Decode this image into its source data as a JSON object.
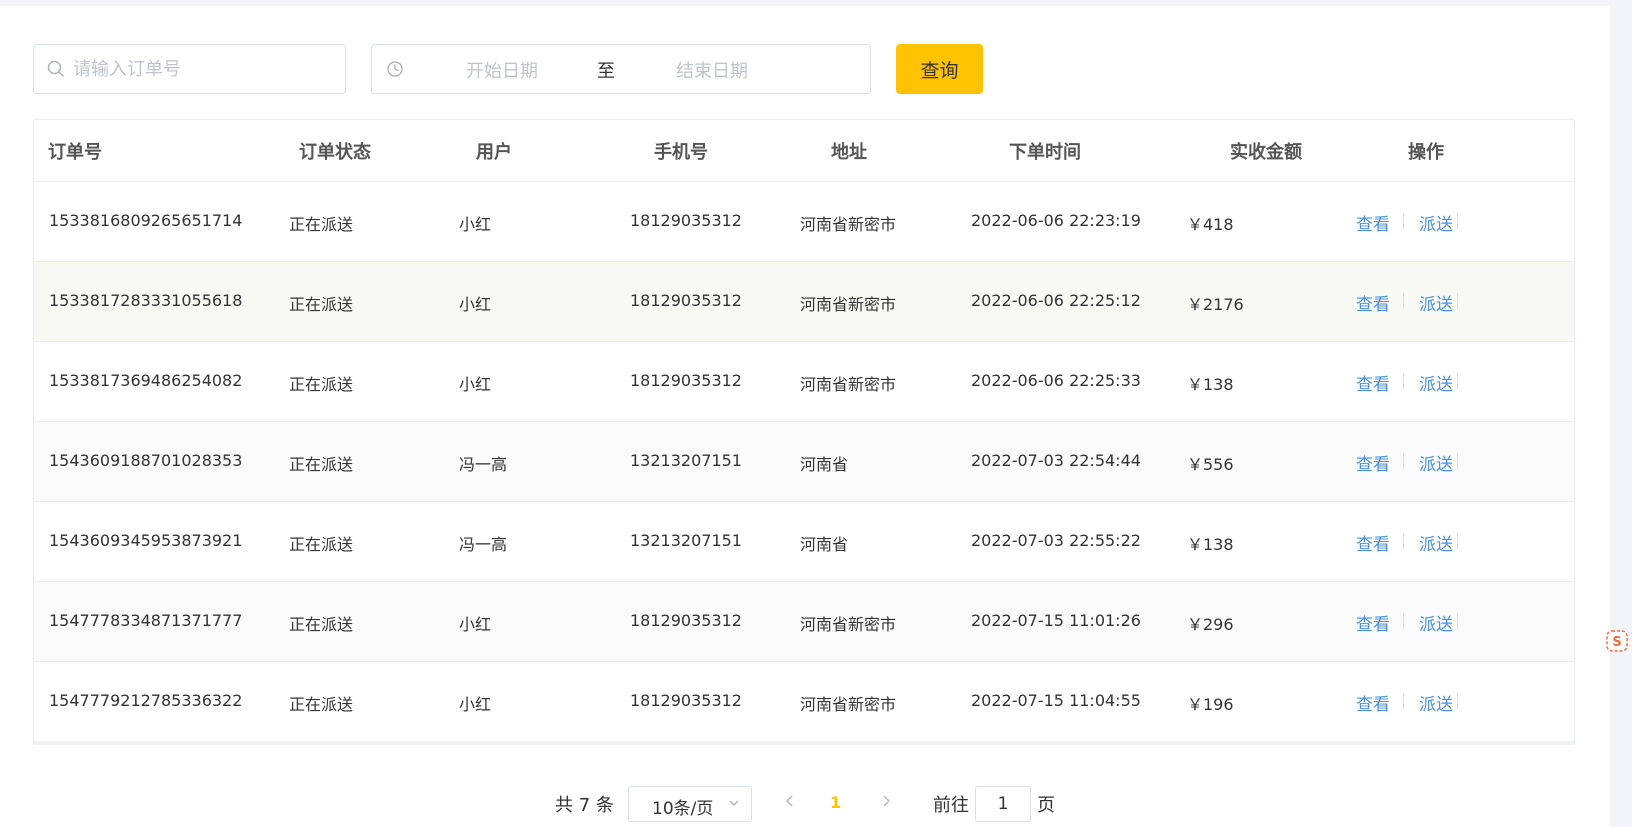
{
  "toolbar": {
    "search_placeholder": "请输入订单号",
    "start_date_placeholder": "开始日期",
    "range_separator": "至",
    "end_date_placeholder": "结束日期",
    "query_label": "查询"
  },
  "table": {
    "headers": [
      "订单号",
      "订单状态",
      "用户",
      "手机号",
      "地址",
      "下单时间",
      "实收金额",
      "操作"
    ],
    "rows": [
      {
        "order_no": "1533816809265651714",
        "status": "正在派送",
        "user": "小红",
        "phone": "18129035312",
        "address": "河南省新密市",
        "time": "2022-06-06 22:23:19",
        "amount": "￥418",
        "view": "查看",
        "dispatch": "派送"
      },
      {
        "order_no": "1533817283331055618",
        "status": "正在派送",
        "user": "小红",
        "phone": "18129035312",
        "address": "河南省新密市",
        "time": "2022-06-06 22:25:12",
        "amount": "￥2176",
        "view": "查看",
        "dispatch": "派送"
      },
      {
        "order_no": "1533817369486254082",
        "status": "正在派送",
        "user": "小红",
        "phone": "18129035312",
        "address": "河南省新密市",
        "time": "2022-06-06 22:25:33",
        "amount": "￥138",
        "view": "查看",
        "dispatch": "派送"
      },
      {
        "order_no": "1543609188701028353",
        "status": "正在派送",
        "user": "冯一高",
        "phone": "13213207151",
        "address": "河南省",
        "time": "2022-07-03 22:54:44",
        "amount": "￥556",
        "view": "查看",
        "dispatch": "派送"
      },
      {
        "order_no": "1543609345953873921",
        "status": "正在派送",
        "user": "冯一高",
        "phone": "13213207151",
        "address": "河南省",
        "time": "2022-07-03 22:55:22",
        "amount": "￥138",
        "view": "查看",
        "dispatch": "派送"
      },
      {
        "order_no": "1547778334871371777",
        "status": "正在派送",
        "user": "小红",
        "phone": "18129035312",
        "address": "河南省新密市",
        "time": "2022-07-15 11:01:26",
        "amount": "￥296",
        "view": "查看",
        "dispatch": "派送"
      },
      {
        "order_no": "1547779212785336322",
        "status": "正在派送",
        "user": "小红",
        "phone": "18129035312",
        "address": "河南省新密市",
        "time": "2022-07-15 11:04:55",
        "amount": "￥196",
        "view": "查看",
        "dispatch": "派送"
      }
    ]
  },
  "pagination": {
    "total_text": "共 7 条",
    "page_size": "10条/页",
    "current_page": "1",
    "goto_label": "前往",
    "goto_value": "1",
    "goto_suffix": "页"
  },
  "colors": {
    "accent": "#ffc200",
    "link": "#4a90e2",
    "border": "#dcdfe6"
  },
  "icons": [
    "search-icon",
    "clock-icon",
    "chevron-down-icon",
    "chevron-left-icon",
    "chevron-right-icon",
    "sogou-ime-icon"
  ]
}
